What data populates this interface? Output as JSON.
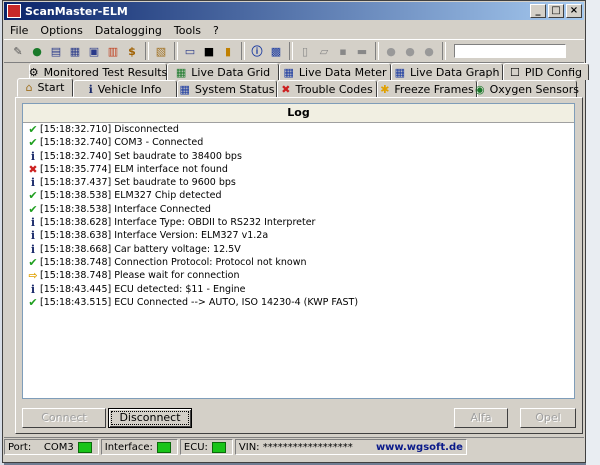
{
  "window": {
    "title": "ScanMaster-ELM"
  },
  "menu": [
    "File",
    "Options",
    "Datalogging",
    "Tools",
    "?"
  ],
  "toolbar_icons": [
    "wrench-icon",
    "globe-icon",
    "doc-icon",
    "grid-icon",
    "meter-icon",
    "graph-icon",
    "dollar-icon",
    "clipboard-icon",
    "chat-icon",
    "terminal-icon",
    "battery-icon",
    "info-icon",
    "disk-icon",
    "new-icon",
    "open-icon",
    "save-icon",
    "print-icon",
    "play-icon",
    "record-icon",
    "stop-icon"
  ],
  "tabs_back": [
    {
      "label": "Monitored Test Results",
      "icon": "⚙"
    },
    {
      "label": "Live Data Grid",
      "icon": "▦"
    },
    {
      "label": "Live Data Meter",
      "icon": "▦"
    },
    {
      "label": "Live Data Graph",
      "icon": "▦"
    },
    {
      "label": "PID Config",
      "icon": "☐"
    }
  ],
  "tabs_front": [
    {
      "label": "Start",
      "icon": "⌂"
    },
    {
      "label": "Vehicle Info",
      "icon": "ℹ"
    },
    {
      "label": "System Status",
      "icon": "▦"
    },
    {
      "label": "Trouble Codes",
      "icon": "✖"
    },
    {
      "label": "Freeze Frames",
      "icon": "✱"
    },
    {
      "label": "Oxygen Sensors",
      "icon": "◉"
    }
  ],
  "log": {
    "header": "Log",
    "entries": [
      {
        "type": "ok",
        "text": "[15:18:32.710] Disconnected"
      },
      {
        "type": "ok",
        "text": "[15:18:32.740] COM3 - Connected"
      },
      {
        "type": "info",
        "text": "[15:18:32.740] Set baudrate to 38400 bps"
      },
      {
        "type": "error",
        "text": "[15:18:35.774] ELM interface not found"
      },
      {
        "type": "info",
        "text": "[15:18:37.437] Set baudrate to 9600 bps"
      },
      {
        "type": "ok",
        "text": "[15:18:38.538] ELM327 Chip detected"
      },
      {
        "type": "ok",
        "text": "[15:18:38.538] Interface Connected"
      },
      {
        "type": "info",
        "text": "[15:18:38.628] Interface Type: OBDII to RS232 Interpreter"
      },
      {
        "type": "info",
        "text": "[15:18:38.638] Interface Version: ELM327 v1.2a"
      },
      {
        "type": "info",
        "text": "[15:18:38.668] Car battery voltage: 12.5V"
      },
      {
        "type": "ok",
        "text": "[15:18:38.748] Connection Protocol: Protocol not known"
      },
      {
        "type": "wait",
        "text": "[15:18:38.748] Please wait for connection"
      },
      {
        "type": "info",
        "text": "[15:18:43.445] ECU detected: $11 - Engine"
      },
      {
        "type": "ok",
        "text": "[15:18:43.515] ECU Connected --> AUTO, ISO 14230-4 (KWP FAST)"
      }
    ]
  },
  "buttons": {
    "connect": "Connect",
    "disconnect": "Disconnect",
    "alfa": "Alfa",
    "opel": "Opel"
  },
  "status": {
    "port_label": "Port:",
    "port_value": "COM3",
    "interface_label": "Interface:",
    "ecu_label": "ECU:",
    "vin_label": "VIN:",
    "vin_value": "******************",
    "url": "www.wgsoft.de"
  },
  "colors": {
    "titlebar_start": "#0a246a",
    "titlebar_end": "#a6caf0",
    "led": "#19c419",
    "ok": "#1e9e1e",
    "error": "#cc2020",
    "info": "#1a2a6a",
    "wait": "#e0a000"
  }
}
